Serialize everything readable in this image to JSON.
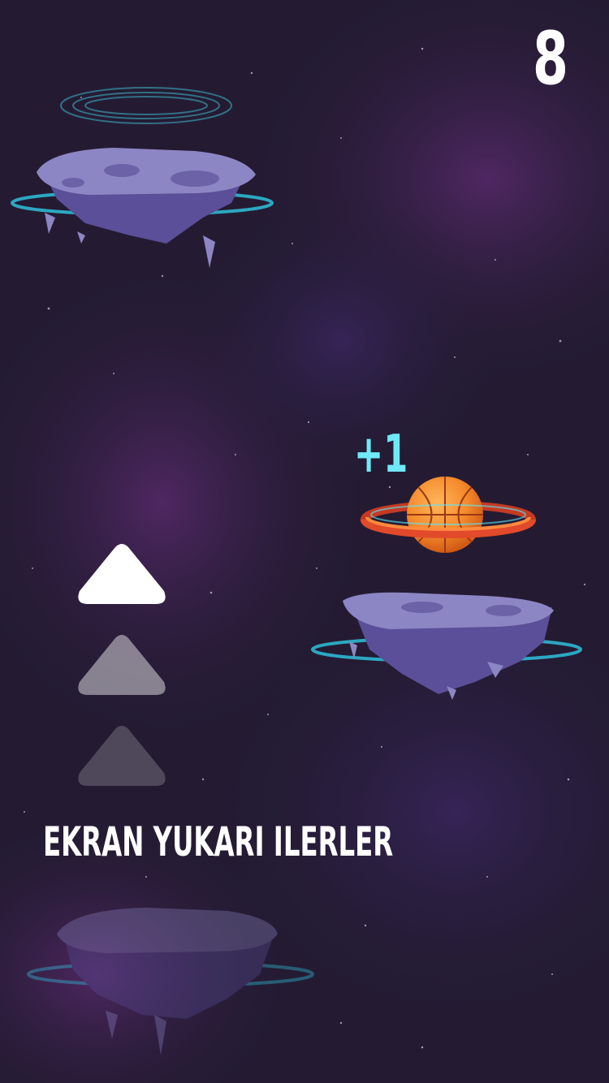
{
  "hud": {
    "score": "8",
    "points_popup": "+1"
  },
  "tutorial": {
    "instruction": "EKRAN YUKARI ILERLER",
    "arrows": [
      {
        "icon": "up-arrow-icon",
        "state": "active"
      },
      {
        "icon": "up-arrow-icon",
        "state": "dim"
      },
      {
        "icon": "up-arrow-icon",
        "state": "faded"
      }
    ]
  },
  "game_objects": {
    "ball": "basketball-icon",
    "ring": "hoop-ring-icon",
    "platforms": [
      "floating-asteroid-platform",
      "floating-asteroid-platform",
      "floating-asteroid-platform"
    ]
  },
  "colors": {
    "background": "#241b33",
    "nebula": "#4a2563",
    "rock": "#6b62a8",
    "rock_light": "#8c86c4",
    "glow": "#2fd8f2",
    "ring": "#e14a2a",
    "ring_inner": "#ff8a3d",
    "ball": "#f58a2c",
    "popup": "#6fe9f7"
  }
}
